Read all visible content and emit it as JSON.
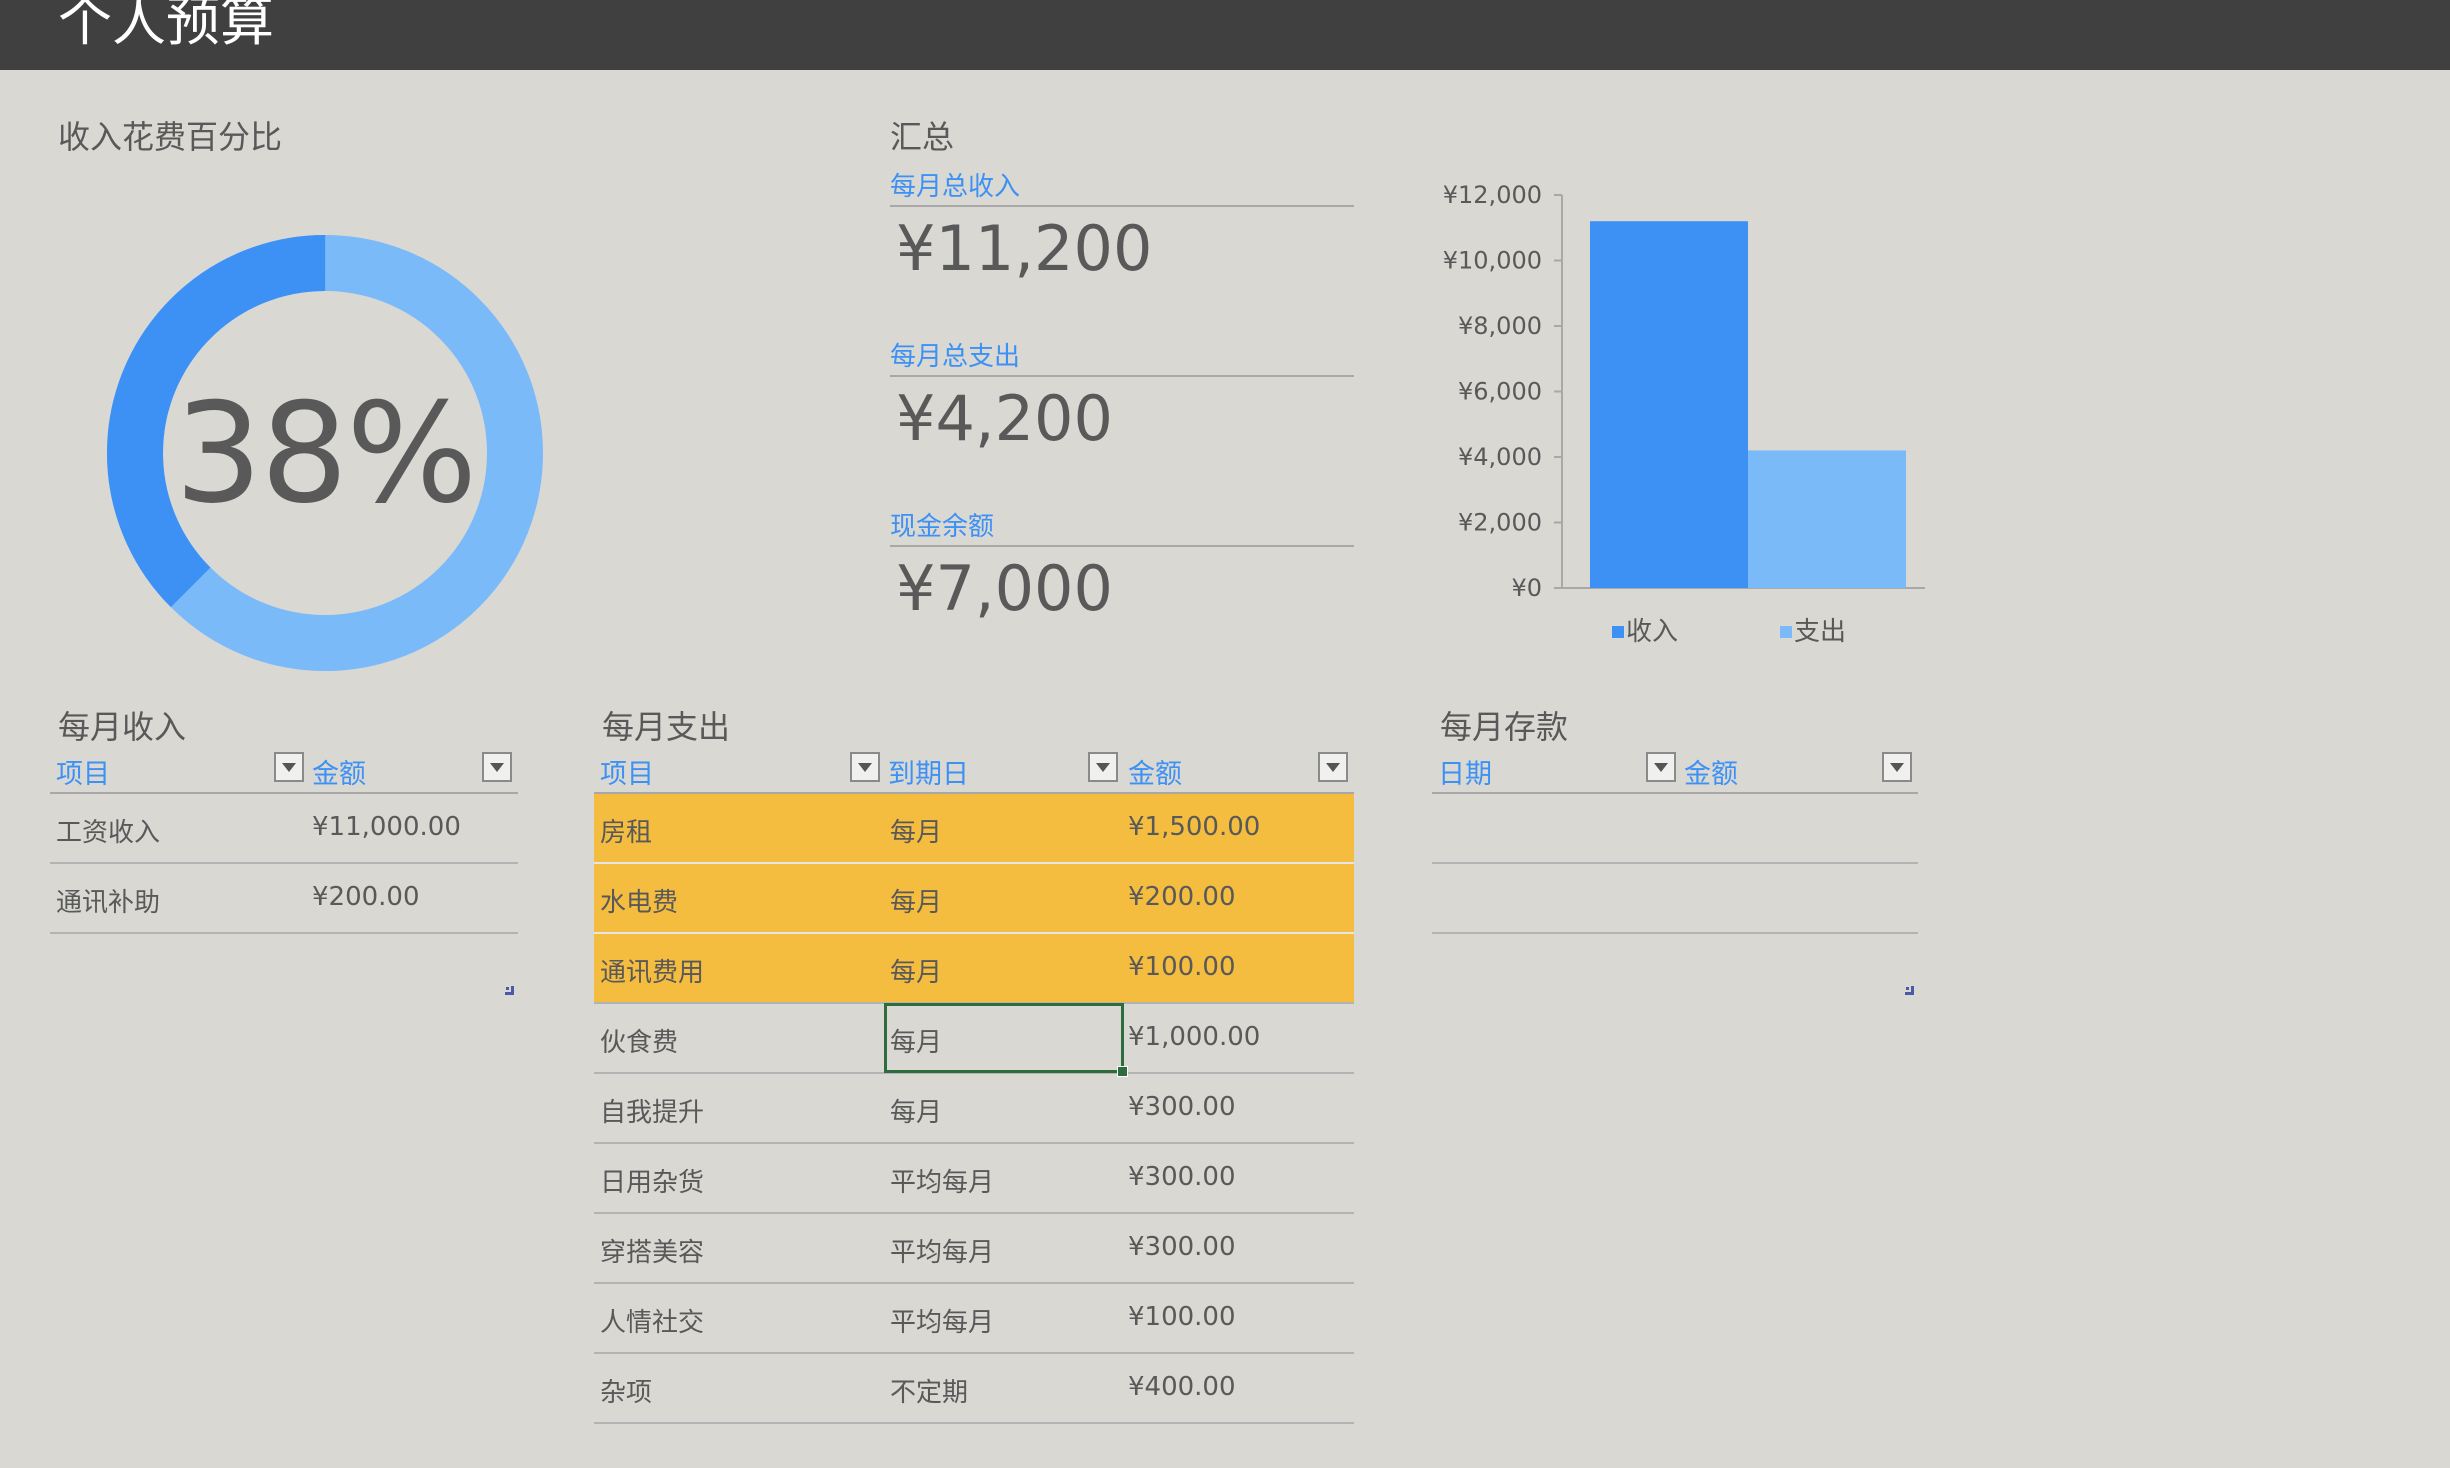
{
  "header": {
    "title": "个人预算"
  },
  "donut": {
    "title": "收入花费百分比",
    "percent_label": "38%",
    "spent_fraction": 0.375,
    "colors": {
      "spent": "#3d91f5",
      "rest": "#7bbaf9"
    }
  },
  "summary": {
    "title": "汇总",
    "items": [
      {
        "label": "每月总收入",
        "value": "¥11,200"
      },
      {
        "label": "每月总支出",
        "value": "¥4,200"
      },
      {
        "label": "现金余额",
        "value": "¥7,000"
      }
    ]
  },
  "chart_data": {
    "type": "bar",
    "categories": [
      "收入",
      "支出"
    ],
    "values": [
      11200,
      4200
    ],
    "ylim": [
      0,
      12000
    ],
    "yticks": [
      "¥0",
      "¥2,000",
      "¥4,000",
      "¥6,000",
      "¥8,000",
      "¥10,000",
      "¥12,000"
    ],
    "ytick_values": [
      0,
      2000,
      4000,
      6000,
      8000,
      10000,
      12000
    ],
    "colors": [
      "#3d91f5",
      "#7bbaf9"
    ],
    "legend": [
      "收入",
      "支出"
    ],
    "legend_position": "bottom",
    "grid": false
  },
  "income": {
    "title": "每月收入",
    "columns": [
      "项目",
      "金额"
    ],
    "rows": [
      [
        "工资收入",
        "¥11,000.00"
      ],
      [
        "通讯补助",
        "¥200.00"
      ]
    ]
  },
  "expense": {
    "title": "每月支出",
    "columns": [
      "项目",
      "到期日",
      "金额"
    ],
    "rows": [
      [
        "房租",
        "每月",
        "¥1,500.00"
      ],
      [
        "水电费",
        "每月",
        "¥200.00"
      ],
      [
        "通讯费用",
        "每月",
        "¥100.00"
      ],
      [
        "伙食费",
        "每月",
        "¥1,000.00"
      ],
      [
        "自我提升",
        "每月",
        "¥300.00"
      ],
      [
        "日用杂货",
        "平均每月",
        "¥300.00"
      ],
      [
        "穿搭美容",
        "平均每月",
        "¥300.00"
      ],
      [
        "人情社交",
        "平均每月",
        "¥100.00"
      ],
      [
        "杂项",
        "不定期",
        "¥400.00"
      ]
    ],
    "highlight_color": "#f5bd40"
  },
  "savings": {
    "title": "每月存款",
    "columns": [
      "日期",
      "金额"
    ]
  }
}
